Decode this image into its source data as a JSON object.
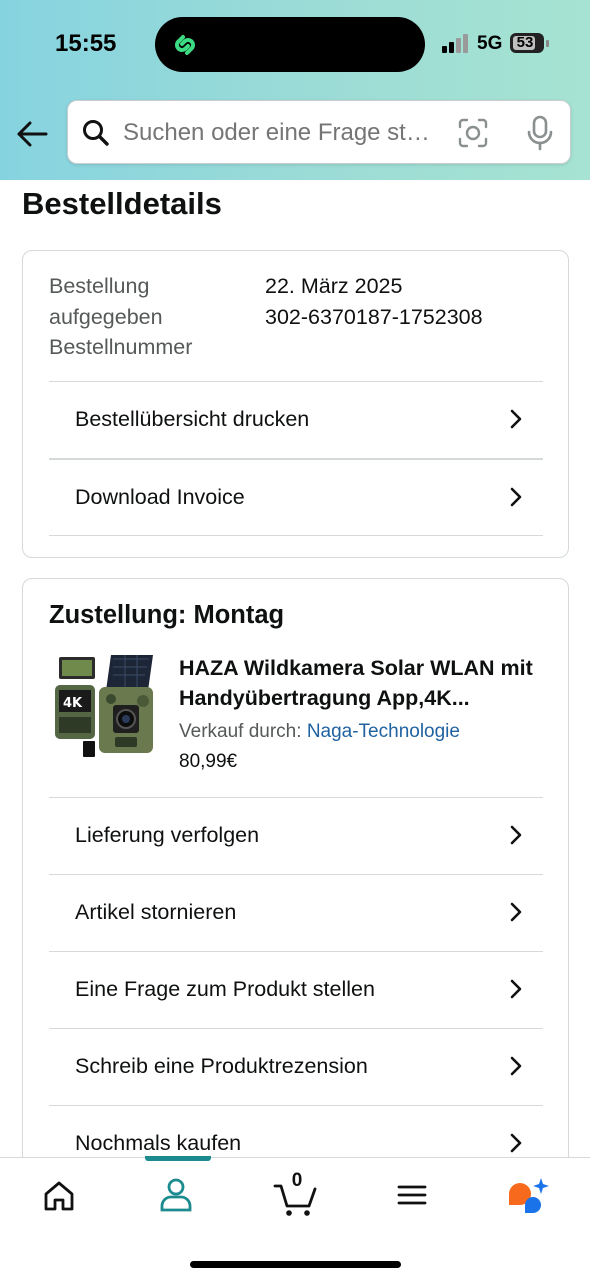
{
  "status_bar": {
    "time": "15:55",
    "network": "5G",
    "battery": "53"
  },
  "search": {
    "placeholder": "Suchen oder eine Frage stellen"
  },
  "page": {
    "title": "Bestelldetails"
  },
  "order_info": {
    "label": "Bestellung aufgegeben Bestellnummer",
    "date": "22. März 2025",
    "number": "302-6370187-1752308",
    "actions": [
      {
        "label": "Bestellübersicht drucken"
      },
      {
        "label": "Download Invoice"
      }
    ]
  },
  "shipment": {
    "title": "Zustellung: Montag",
    "product": {
      "title": "HAZA Wildkamera Solar WLAN mit Handyübertragung App,4K...",
      "seller_prefix": "Verkauf durch:",
      "seller_name": "Naga-Technologie",
      "price": "80,99€"
    },
    "actions": [
      {
        "label": "Lieferung verfolgen"
      },
      {
        "label": "Artikel stornieren"
      },
      {
        "label": "Eine Frage zum Produkt stellen"
      },
      {
        "label": "Schreib eine Produktrezension"
      },
      {
        "label": "Nochmals kaufen"
      }
    ]
  },
  "tabbar": {
    "active": "account",
    "cart_count": "0",
    "tabs": [
      {
        "id": "home",
        "icon": "home-icon"
      },
      {
        "id": "account",
        "icon": "user-icon"
      },
      {
        "id": "cart",
        "icon": "cart-icon"
      },
      {
        "id": "menu",
        "icon": "menu-icon"
      },
      {
        "id": "rufus",
        "icon": "ai-assistant-icon"
      }
    ]
  },
  "colors": {
    "accent": "#1c8b8f",
    "link": "#2162a1",
    "header_start": "#86d3e0",
    "header_end": "#a6e3d2"
  }
}
